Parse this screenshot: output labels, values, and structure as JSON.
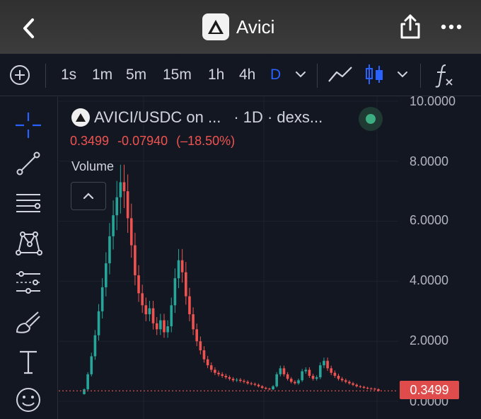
{
  "header": {
    "title": "Avici",
    "back_icon": "chevron-left-icon",
    "share_icon": "share-icon",
    "more_icon": "more-dots-icon"
  },
  "toolbar": {
    "intervals": [
      "1s",
      "1m",
      "5m",
      "15m",
      "1h",
      "4h",
      "D"
    ],
    "active_interval": "D",
    "icons": [
      "add-circle-icon",
      "chevron-down-icon",
      "line-chart-icon",
      "candlestick-icon",
      "chevron-down-icon",
      "indicators-fx-icon"
    ]
  },
  "sidebar": {
    "tools": [
      "crosshair-icon",
      "trendline-icon",
      "fib-retracement-icon",
      "pattern-icon",
      "prediction-icon",
      "brush-icon",
      "text-tool-icon",
      "emoji-icon"
    ]
  },
  "chart": {
    "symbol": "AVICI/USDC on ...",
    "meta": "· 1D · dexs...",
    "last_price": "0.3499",
    "change": "-0.07940",
    "change_pct": "(–18.50%)",
    "volume_label": "Volume",
    "price_tag": "0.3499",
    "y_labels": [
      "10.0000",
      "8.0000",
      "6.0000",
      "4.0000",
      "2.0000",
      "0.0000"
    ],
    "colors": {
      "up": "#26a69a",
      "down": "#ef5350",
      "accent": "#2962ff"
    }
  },
  "chart_data": {
    "type": "candlestick",
    "title": "AVICI/USDC on ... · 1D · dexs...",
    "ylim": [
      0,
      10
    ],
    "y_ticks": [
      0,
      2,
      4,
      6,
      8,
      10
    ],
    "last_value": 0.3499,
    "series": [
      {
        "values": [
          0.4,
          0.9,
          1.5,
          2.2,
          3.0,
          3.8,
          4.6,
          5.5,
          6.2,
          6.8,
          7.3,
          7.0,
          6.1,
          5.2,
          4.2,
          3.6,
          3.2,
          2.9,
          3.1,
          2.6,
          2.4,
          2.7,
          2.3,
          2.5,
          3.2,
          4.1,
          4.7,
          4.3,
          3.5,
          2.9,
          2.4,
          2.0,
          1.7,
          1.4,
          1.2,
          1.05,
          0.95,
          0.9,
          0.85,
          0.8,
          0.75,
          0.7,
          0.72,
          0.68,
          0.65,
          0.6,
          0.58,
          0.55,
          0.5,
          0.45,
          0.42,
          0.4,
          0.5,
          0.9,
          1.1,
          0.9,
          0.75,
          0.65,
          0.6,
          0.7,
          1.0,
          1.05,
          0.85,
          0.75,
          0.8,
          1.2,
          1.35,
          1.1,
          0.95,
          0.85,
          0.75,
          0.7,
          0.65,
          0.6,
          0.55,
          0.5,
          0.48,
          0.45,
          0.43,
          0.42,
          0.4,
          0.35
        ]
      }
    ]
  }
}
